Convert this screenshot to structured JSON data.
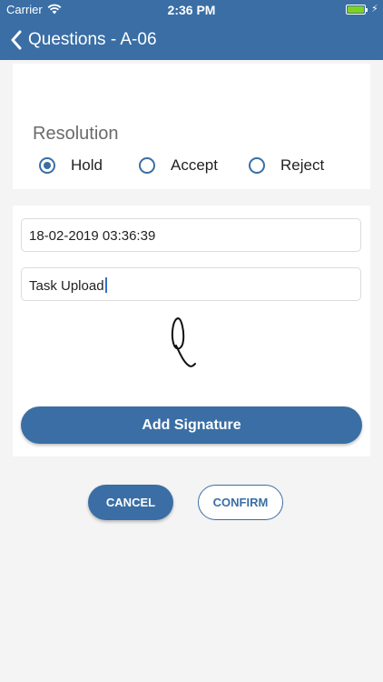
{
  "status_bar": {
    "carrier": "Carrier",
    "time": "2:36 PM",
    "wifi_icon": "wifi-icon",
    "battery_icon": "battery-icon",
    "battery_level": 1.0,
    "charging_icon": "bolt-icon"
  },
  "nav": {
    "back_icon": "chevron-left-icon",
    "title": "Questions - A-06"
  },
  "resolution": {
    "label": "Resolution",
    "options": [
      {
        "label": "Hold",
        "selected": true
      },
      {
        "label": "Accept",
        "selected": false
      },
      {
        "label": "Reject",
        "selected": false
      }
    ]
  },
  "form": {
    "date_value": "18-02-2019 03:36:39",
    "task_value": "Task Upload"
  },
  "actions": {
    "add_signature_label": "Add Signature",
    "cancel_label": "CANCEL",
    "confirm_label": "CONFIRM"
  },
  "colors": {
    "primary": "#3a6ea5",
    "background": "#f4f4f4",
    "battery": "#7ed321"
  }
}
